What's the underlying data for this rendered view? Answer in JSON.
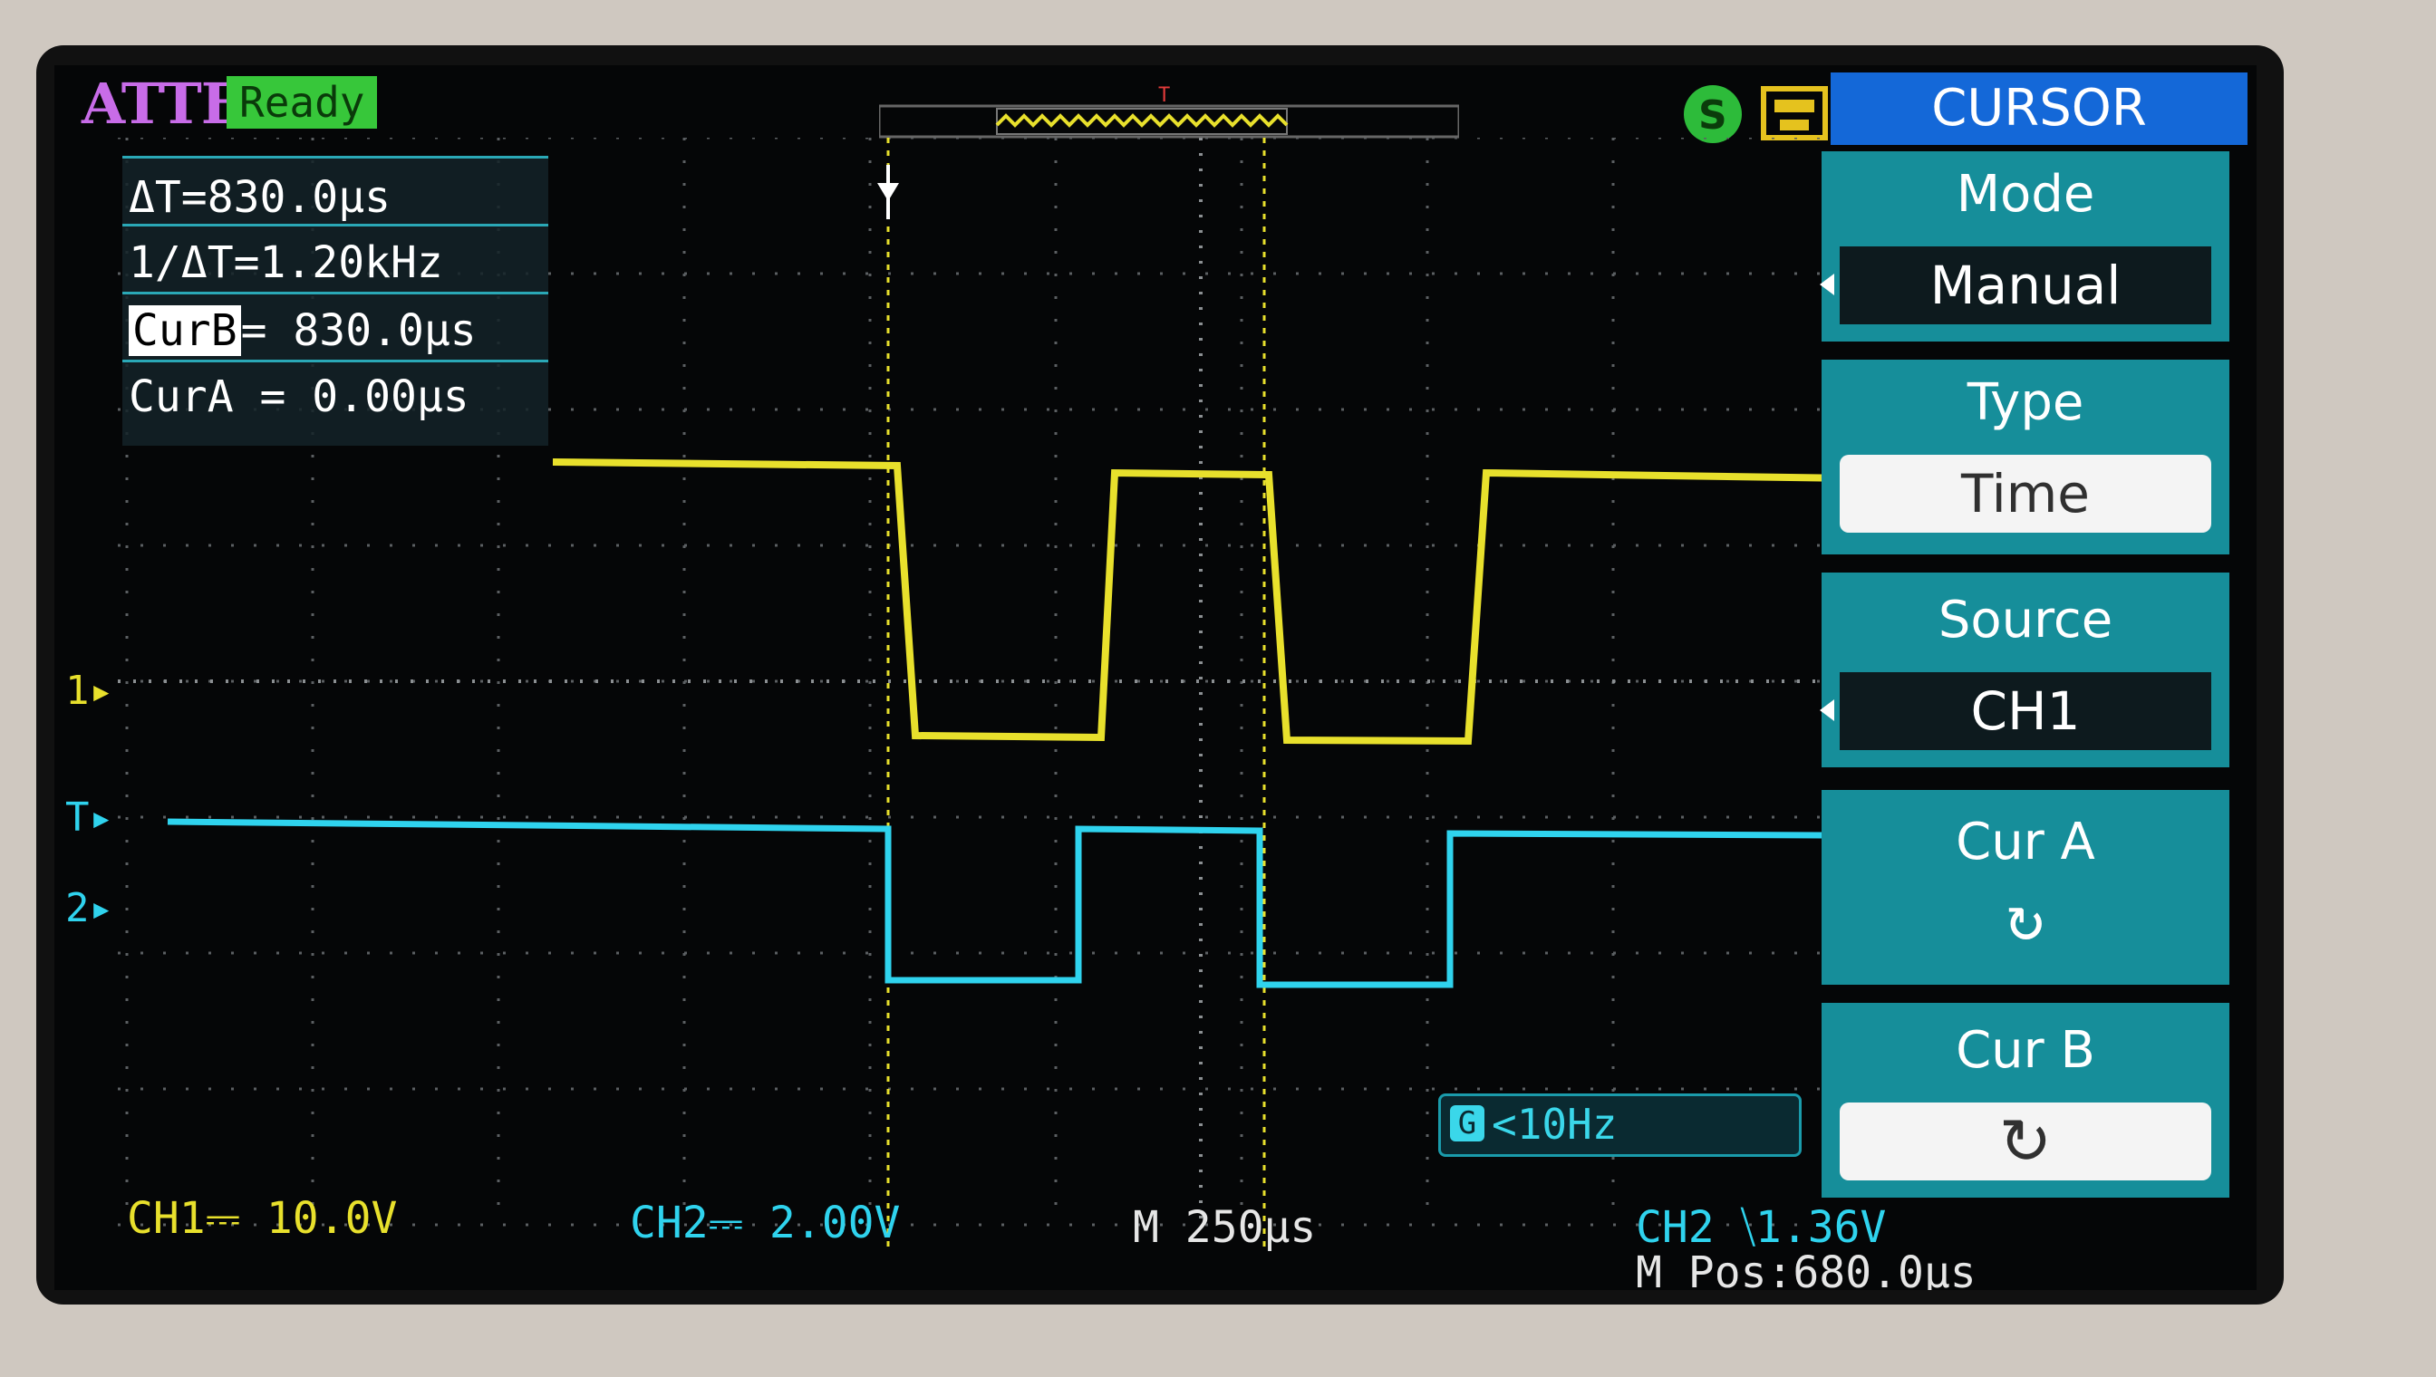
{
  "header": {
    "brand": "ATTEN",
    "status": "Ready"
  },
  "trigger_marker": "T",
  "cursor_readouts": {
    "delta_t": "ΔT=830.0μs",
    "inverse_delta_t": "1/ΔT=1.20kHz",
    "cur_b_label": "CurB",
    "cur_b_value": "= 830.0μs",
    "cur_a": "CurA = 0.00μs"
  },
  "channel_markers": {
    "ch1": "1",
    "trigger": "T",
    "ch2": "2"
  },
  "frequency": {
    "gate_icon": "gate-icon",
    "value": "<10Hz"
  },
  "bottom_bar": {
    "ch1_scale": "CH1⎓ 10.0V",
    "ch2_scale": "CH2⎓ 2.00V",
    "timebase": "M 250μs",
    "trigger_info": "CH2 ⧹1.36V",
    "m_pos": "M Pos:680.0μs"
  },
  "menu": {
    "title": "CURSOR",
    "mode_label": "Mode",
    "mode_value": "Manual",
    "type_label": "Type",
    "type_value": "Time",
    "source_label": "Source",
    "source_value": "CH1",
    "cur_a_label": "Cur A",
    "cur_b_label": "Cur B"
  },
  "colors": {
    "ch1": "#e8e02c",
    "ch2": "#2fd3ee",
    "menu_panel": "#168e9a",
    "menu_title": "#1468d8",
    "brand": "#c86ce8",
    "status": "#37c73a"
  }
}
